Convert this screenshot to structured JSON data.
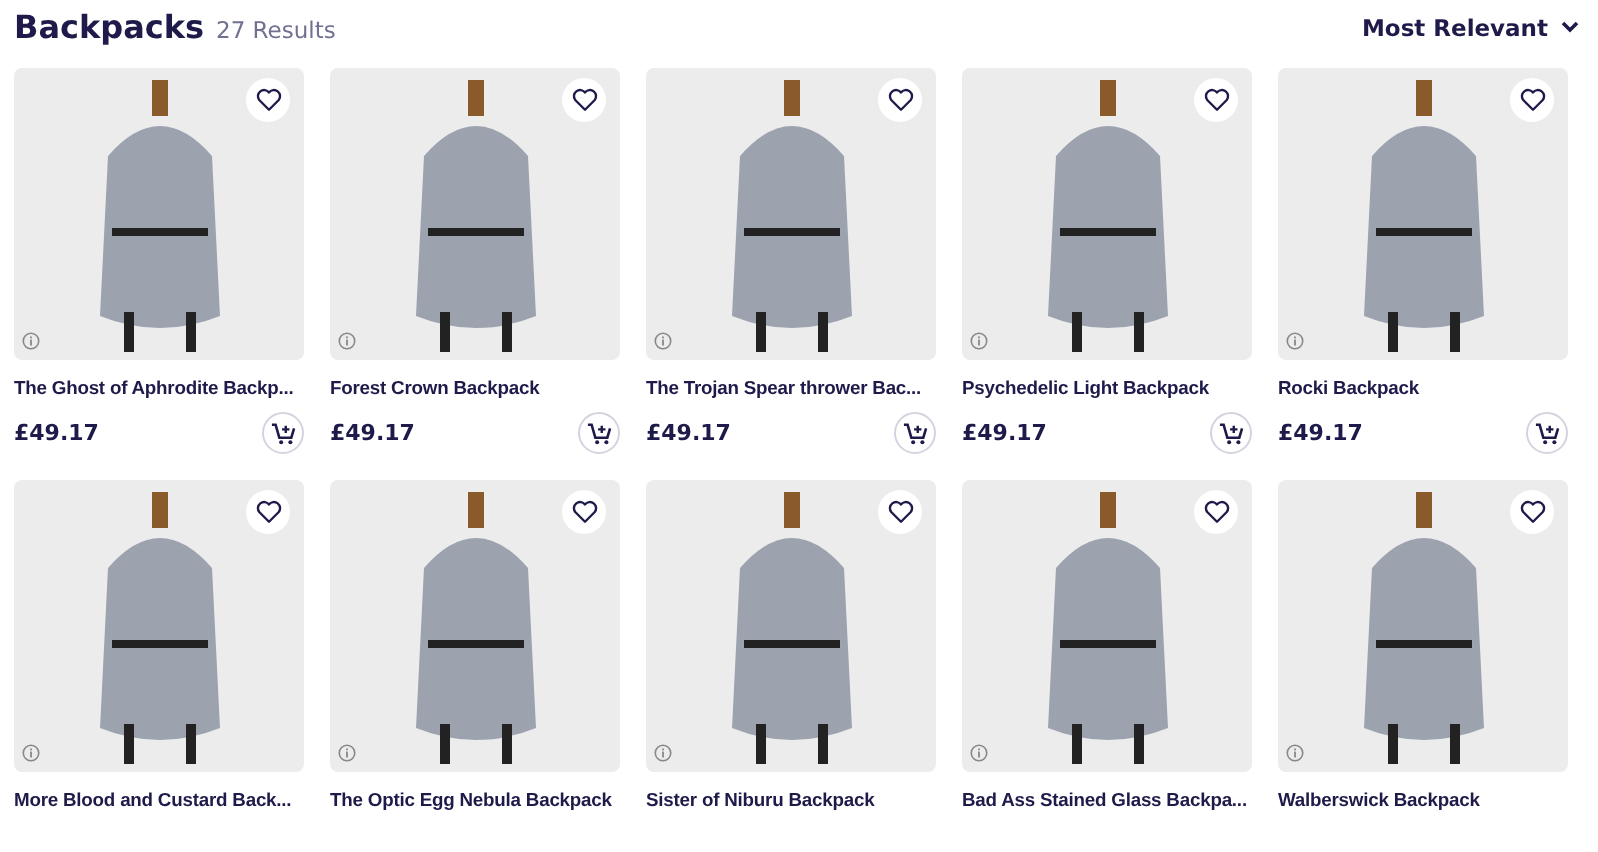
{
  "header": {
    "title": "Backpacks",
    "count": "27 Results",
    "sort": "Most Relevant"
  },
  "products": [
    {
      "title": "The Ghost of Aphrodite Backp...",
      "price": "£49.17"
    },
    {
      "title": "Forest Crown Backpack",
      "price": "£49.17"
    },
    {
      "title": "The Trojan Spear thrower Bac...",
      "price": "£49.17"
    },
    {
      "title": "Psychedelic Light Backpack",
      "price": "£49.17"
    },
    {
      "title": "Rocki Backpack",
      "price": "£49.17"
    },
    {
      "title": "More Blood and Custard Back..."
    },
    {
      "title": "The Optic Egg Nebula Backpack"
    },
    {
      "title": "Sister of Niburu Backpack"
    },
    {
      "title": "Bad Ass Stained Glass Backpa..."
    },
    {
      "title": "Walberswick Backpack"
    }
  ]
}
